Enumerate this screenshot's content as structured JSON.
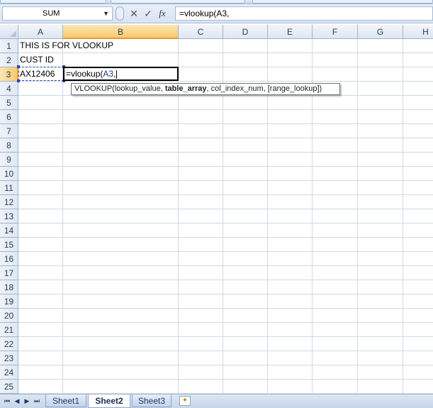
{
  "name_box": {
    "value": "SUM"
  },
  "formula_bar": {
    "value": "=vlookup(A3,"
  },
  "columns": [
    "A",
    "B",
    "C",
    "D",
    "E",
    "F",
    "G",
    "H"
  ],
  "rows": [
    "1",
    "2",
    "3",
    "4",
    "5",
    "6",
    "7",
    "8",
    "9",
    "10",
    "11",
    "12",
    "13",
    "14",
    "15",
    "16",
    "17",
    "18",
    "19",
    "20",
    "21",
    "22",
    "23",
    "24",
    "25"
  ],
  "cells": {
    "A1": "THIS IS FOR VLOOKUP",
    "A2": "CUST ID",
    "A3": "AX12406"
  },
  "edit_cell": {
    "prefix": "=vlookup(",
    "ref": "A3",
    "suffix": ","
  },
  "tooltip": {
    "func": "VLOOKUP(",
    "arg1": "lookup_value, ",
    "arg2_bold": "table_array",
    "rest": ", col_index_num, [range_lookup])"
  },
  "sheet_tabs": [
    "Sheet1",
    "Sheet2",
    "Sheet3"
  ],
  "active_sheet": "Sheet2",
  "icons": {
    "name_box_dropdown": "chevron-down-icon",
    "cancel": "close-icon",
    "enter": "check-icon",
    "insert_function": "fx-icon",
    "new_sheet": "new-sheet-icon"
  }
}
